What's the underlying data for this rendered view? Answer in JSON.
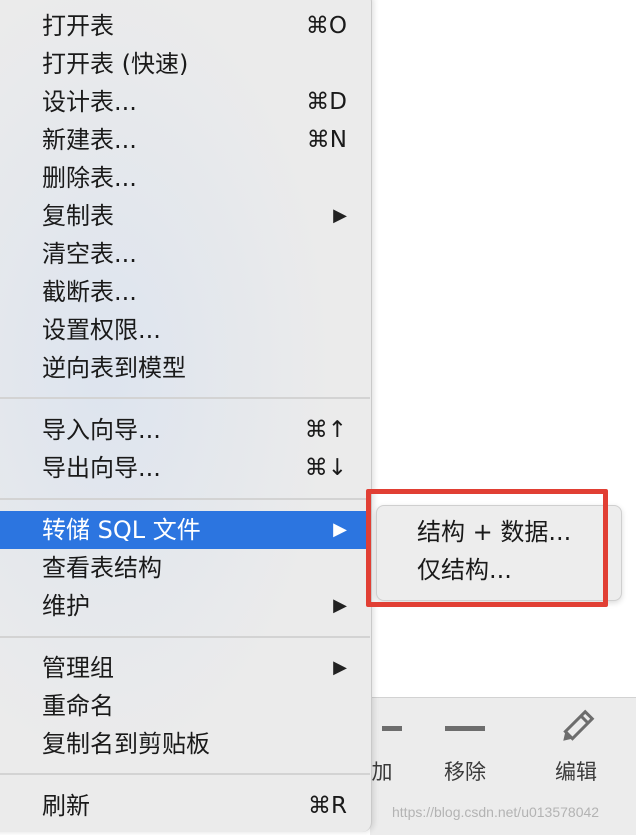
{
  "menu": {
    "items": [
      {
        "label": "打开表",
        "shortcut": "⌘O"
      },
      {
        "label": "打开表 (快速)",
        "shortcut": ""
      },
      {
        "label": "设计表...",
        "shortcut": "⌘D"
      },
      {
        "label": "新建表...",
        "shortcut": "⌘N"
      },
      {
        "label": "删除表...",
        "shortcut": ""
      },
      {
        "label": "复制表",
        "shortcut": ""
      },
      {
        "label": "清空表...",
        "shortcut": ""
      },
      {
        "label": "截断表...",
        "shortcut": ""
      },
      {
        "label": "设置权限...",
        "shortcut": ""
      },
      {
        "label": "逆向表到模型",
        "shortcut": ""
      },
      {
        "label": "导入向导...",
        "shortcut": "⌘↑"
      },
      {
        "label": "导出向导...",
        "shortcut": "⌘↓"
      },
      {
        "label": "转储 SQL 文件",
        "shortcut": ""
      },
      {
        "label": "查看表结构",
        "shortcut": ""
      },
      {
        "label": "维护",
        "shortcut": ""
      },
      {
        "label": "管理组",
        "shortcut": ""
      },
      {
        "label": "重命名",
        "shortcut": ""
      },
      {
        "label": "复制名到剪贴板",
        "shortcut": ""
      },
      {
        "label": "刷新",
        "shortcut": "⌘R"
      }
    ],
    "submenu_arrow": "▶"
  },
  "submenu": {
    "items": [
      {
        "label": "结构 + 数据..."
      },
      {
        "label": "仅结构..."
      }
    ]
  },
  "toolbar": {
    "partial_label": "加",
    "remove_label": "移除",
    "edit_label": "编辑"
  },
  "watermark": "https://blog.csdn.net/u013578042",
  "colors": {
    "menu_bg": "#ebebeb",
    "highlight_bg": "#2c75e0",
    "annotation_red": "#e13f34"
  }
}
